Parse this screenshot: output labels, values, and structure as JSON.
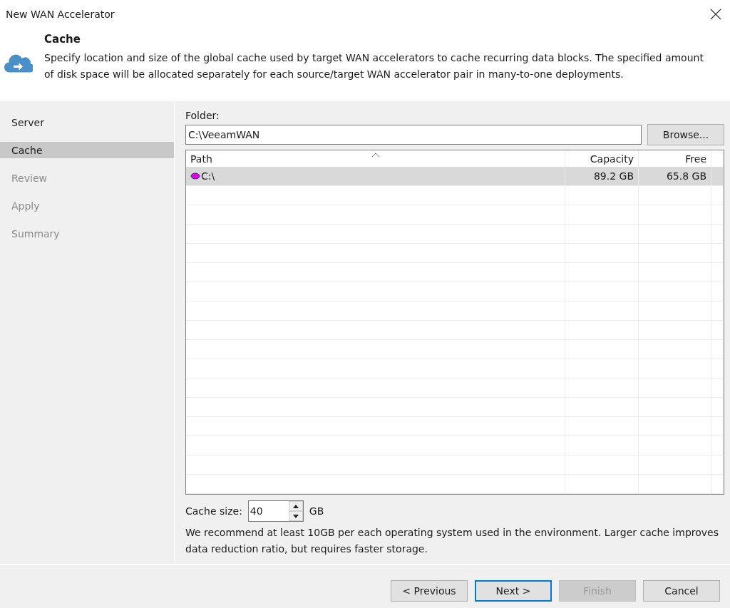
{
  "window": {
    "title": "New WAN Accelerator"
  },
  "header": {
    "title": "Cache",
    "description": "Specify location and size of the global cache used by target WAN accelerators to cache recurring data blocks. The specified amount of disk space will be allocated separately for each source/target WAN accelerator pair in many-to-one deployments."
  },
  "steps": [
    {
      "label": "Server",
      "selected": false,
      "disabled": false
    },
    {
      "label": "Cache",
      "selected": true,
      "disabled": false
    },
    {
      "label": "Review",
      "selected": false,
      "disabled": true
    },
    {
      "label": "Apply",
      "selected": false,
      "disabled": true
    },
    {
      "label": "Summary",
      "selected": false,
      "disabled": true
    }
  ],
  "folder": {
    "label": "Folder:",
    "value": "C:\\VeeamWAN",
    "browse": "Browse..."
  },
  "table": {
    "columns": [
      "Path",
      "Capacity",
      "Free"
    ],
    "rows": [
      {
        "path": "C:\\",
        "capacity": "89.2 GB",
        "free": "65.8 GB",
        "selected": true
      }
    ]
  },
  "cache_size": {
    "label": "Cache size:",
    "value": "40",
    "unit": "GB",
    "note": "We recommend at least 10GB per each operating system used in the environment. Larger cache improves data reduction ratio, but requires faster storage."
  },
  "buttons": [
    {
      "label": "< Previous",
      "disabled": false,
      "default": false
    },
    {
      "label": "Next >",
      "disabled": false,
      "default": true
    },
    {
      "label": "Finish",
      "disabled": true,
      "default": false
    },
    {
      "label": "Cancel",
      "disabled": false,
      "default": false
    }
  ]
}
